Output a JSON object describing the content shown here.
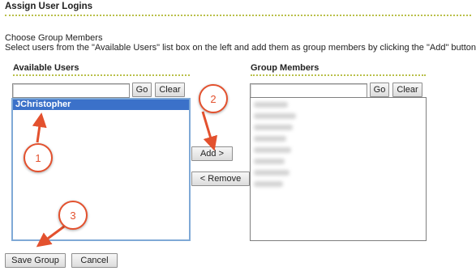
{
  "section_title": "Assign User Logins",
  "instructions": {
    "heading": "Choose Group Members",
    "text": "Select users from the \"Available Users\" list box on the left and add them as group members by clicking the \"Add\" button."
  },
  "available_users": {
    "heading": "Available Users",
    "search_value": "",
    "go_label": "Go",
    "clear_label": "Clear",
    "items": [
      "JChristopher"
    ]
  },
  "group_members": {
    "heading": "Group Members",
    "search_value": "",
    "go_label": "Go",
    "clear_label": "Clear"
  },
  "buttons": {
    "add_label": "Add >",
    "remove_label": "< Remove",
    "save_label": "Save Group",
    "cancel_label": "Cancel"
  },
  "callouts": [
    "1",
    "2",
    "3"
  ],
  "colors": {
    "accent_rule": "#b9c04a",
    "selection": "#3b71c9",
    "callout": "#e3512e"
  }
}
